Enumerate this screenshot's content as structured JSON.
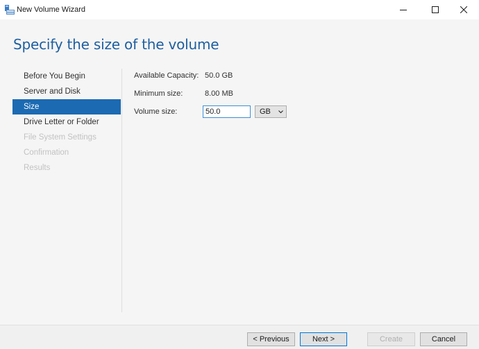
{
  "window": {
    "title": "New Volume Wizard",
    "icon": "volume-wizard-icon",
    "controls": [
      "minimize-icon",
      "maximize-icon",
      "close-icon"
    ]
  },
  "heading": "Specify the size of the volume",
  "nav": {
    "items": [
      {
        "label": "Before You Begin",
        "state": "normal"
      },
      {
        "label": "Server and Disk",
        "state": "normal"
      },
      {
        "label": "Size",
        "state": "active"
      },
      {
        "label": "Drive Letter or Folder",
        "state": "normal"
      },
      {
        "label": "File System Settings",
        "state": "disabled"
      },
      {
        "label": "Confirmation",
        "state": "disabled"
      },
      {
        "label": "Results",
        "state": "disabled"
      }
    ]
  },
  "form": {
    "available_label": "Available Capacity:",
    "available_value": "50.0 GB",
    "minimum_label": "Minimum size:",
    "minimum_value": "8.00 MB",
    "volume_size_label": "Volume size:",
    "volume_size_value": "50.0",
    "unit_selected": "GB"
  },
  "buttons": {
    "previous": "< Previous",
    "next": "Next >",
    "create": "Create",
    "cancel": "Cancel"
  },
  "colors": {
    "accent": "#1c6ab2",
    "heading": "#1e5fa0",
    "disabled_text": "#c2c2c2"
  }
}
